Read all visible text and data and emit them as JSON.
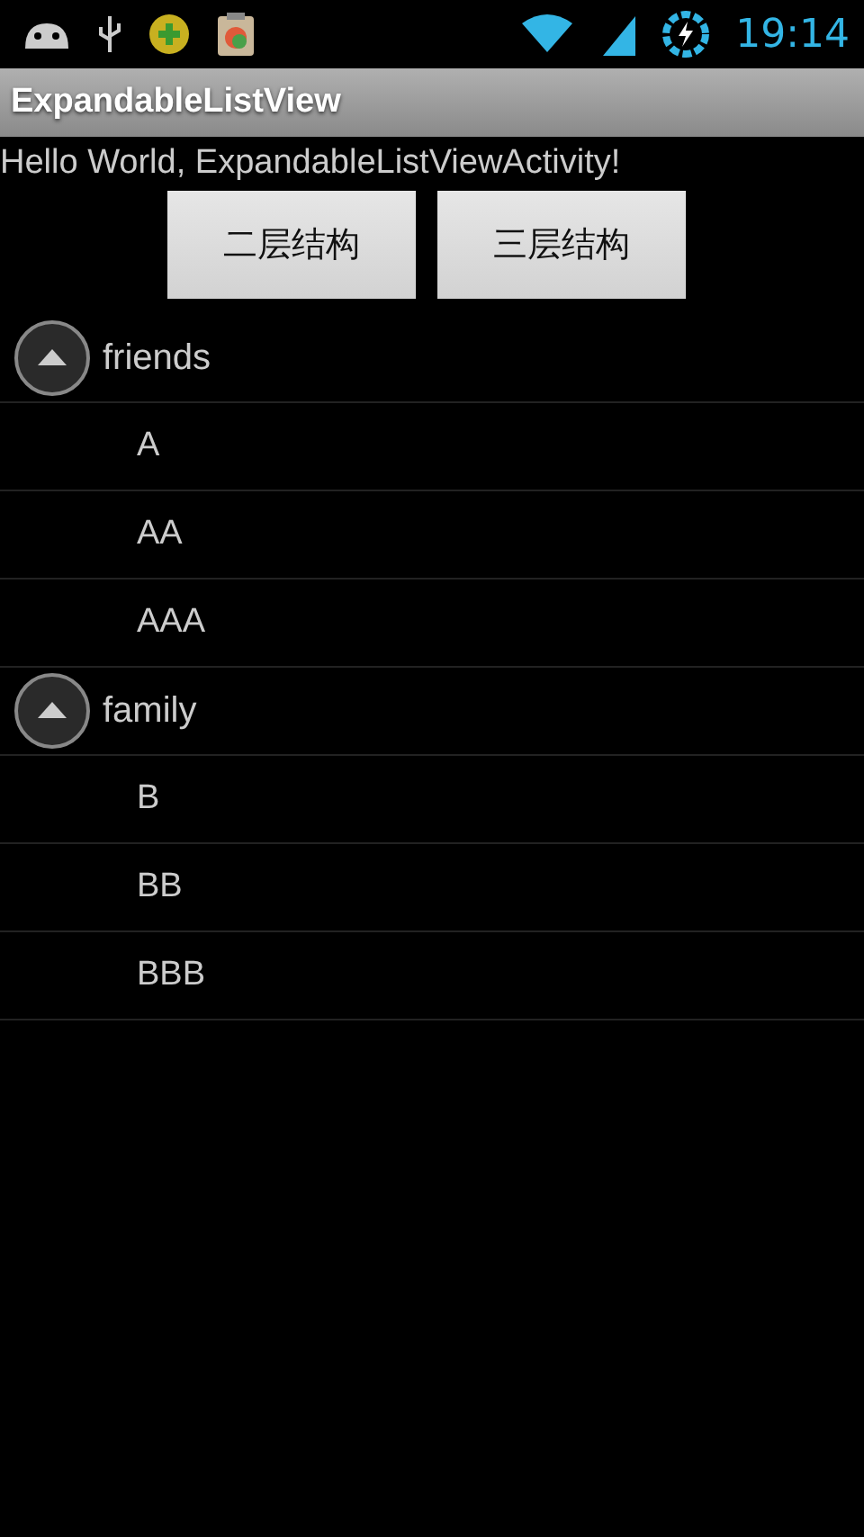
{
  "status_bar": {
    "time": "19:14"
  },
  "action_bar": {
    "title": "ExpandableListView"
  },
  "greeting": "Hello World, ExpandableListViewActivity!",
  "buttons": [
    "二层结构",
    "三层结构"
  ],
  "groups": [
    {
      "label": "friends",
      "expanded": true,
      "children": [
        {
          "label": "A"
        },
        {
          "label": "AA"
        },
        {
          "label": "AAA"
        }
      ]
    },
    {
      "label": "family",
      "expanded": true,
      "children": [
        {
          "label": "B"
        },
        {
          "label": "BB"
        },
        {
          "label": "BBB"
        }
      ]
    }
  ]
}
